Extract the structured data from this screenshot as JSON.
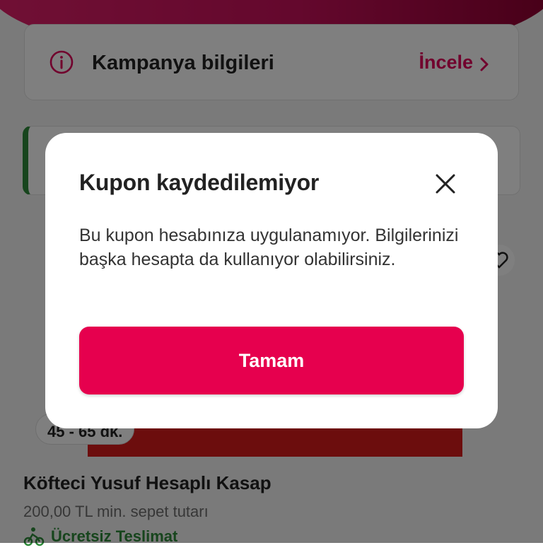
{
  "background": {
    "campaign": {
      "title": "Kampanya bilgileri",
      "link_label": "İncele",
      "info_icon": "info-icon",
      "link_icon": "chevron-right-icon"
    },
    "store": {
      "delivery_time": "45 - 65 dk.",
      "name": "Köfteci Yusuf Hesaplı Kasap",
      "min_basket": "200,00 TL min. sepet tutarı",
      "delivery_label": "Ücretsiz Teslimat",
      "delivery_icon": "courier-icon"
    }
  },
  "dialog": {
    "title": "Kupon kaydedilemiyor",
    "message": "Bu kupon hesabınıza uygulanamıyor. Bilgilerinizi başka hesapta da kullanıyor olabilirsiniz.",
    "confirm_label": "Tamam",
    "close_icon": "close-icon"
  },
  "colors": {
    "brand": "#e6004e",
    "header_gradient_end": "#8e0030",
    "success_green": "#2e8b3a",
    "overlay": "rgba(0,0,0,0.5)"
  }
}
